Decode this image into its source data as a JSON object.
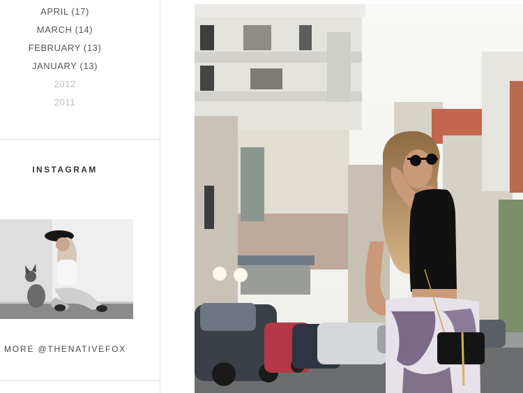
{
  "archive": {
    "months": [
      {
        "label": "APRIL (17)"
      },
      {
        "label": "MARCH (14)"
      },
      {
        "label": "FEBRUARY (13)"
      },
      {
        "label": "JANUARY (13)"
      }
    ],
    "years": [
      {
        "label": "2012"
      },
      {
        "label": "2011"
      }
    ]
  },
  "instagram": {
    "heading": "INSTAGRAM",
    "more_label": "MORE @THENATIVEFOX"
  },
  "colors": {
    "text": "#555555",
    "muted": "#bdbdbd",
    "divider": "#e2e2e2"
  }
}
